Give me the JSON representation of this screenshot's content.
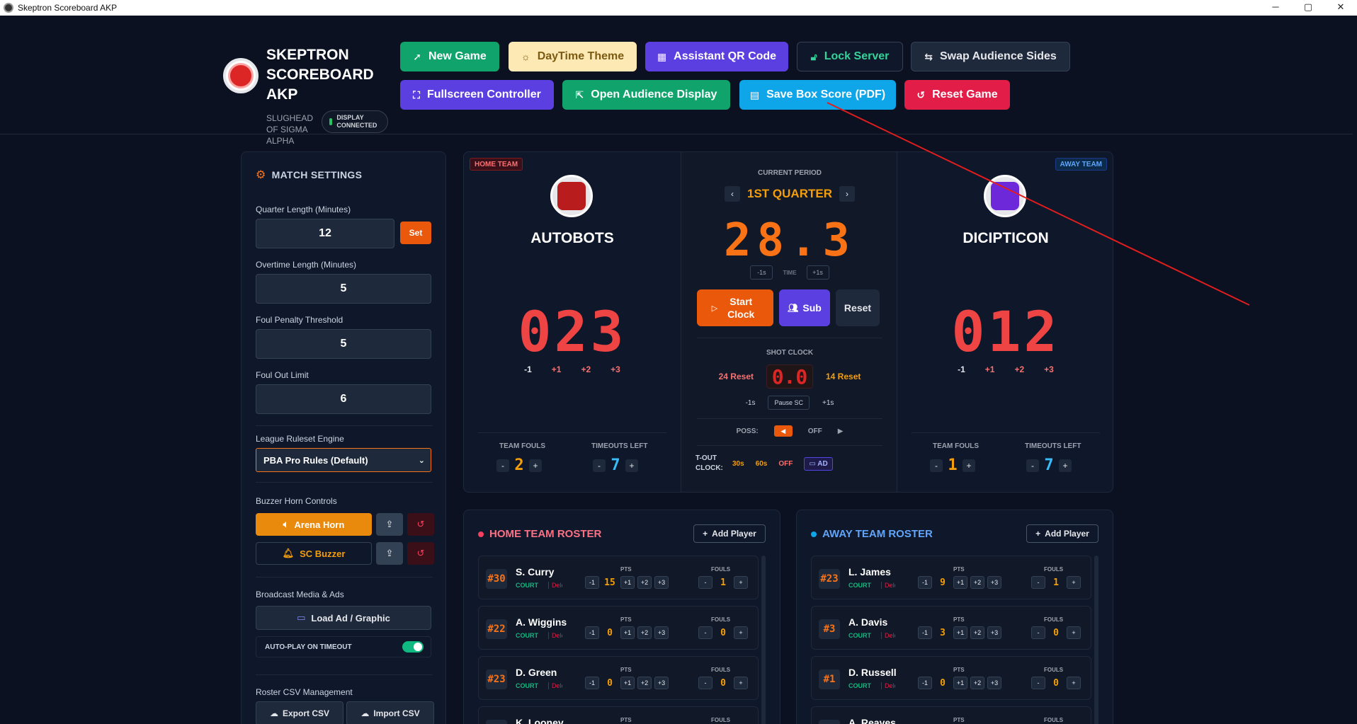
{
  "window": {
    "title": "Skeptron Scoreboard AKP",
    "controls": [
      "─",
      "▢",
      "✕"
    ]
  },
  "brand": {
    "title": "SKEPTRON SCOREBOARD AKP",
    "subtitle": "SLUGHEAD OF SIGMA ALPHA",
    "status": "DISPLAY CONNECTED"
  },
  "toolbar": {
    "new_game": "New Game",
    "daytime_theme": "DayTime Theme",
    "assistant_qr": "Assistant QR Code",
    "lock_server": "Lock Server",
    "swap_sides": "Swap Audience Sides",
    "fullscreen": "Fullscreen Controller",
    "open_display": "Open Audience Display",
    "save_box": "Save Box Score (PDF)",
    "reset_game": "Reset Game"
  },
  "settings": {
    "title": "MATCH SETTINGS",
    "quarter_label": "Quarter Length (Minutes)",
    "quarter_value": "12",
    "set_label": "Set",
    "ot_label": "Overtime Length (Minutes)",
    "ot_value": "5",
    "foul_penalty_label": "Foul Penalty Threshold",
    "foul_penalty_value": "5",
    "foul_out_label": "Foul Out Limit",
    "foul_out_value": "6",
    "ruleset_label": "League Ruleset Engine",
    "ruleset_value": "PBA Pro Rules (Default)",
    "horn_label": "Buzzer Horn Controls",
    "arena_horn": "Arena Horn",
    "sc_buzzer": "SC Buzzer",
    "media_label": "Broadcast Media & Ads",
    "load_ad": "Load Ad / Graphic",
    "autoplay": "AUTO-PLAY ON TIMEOUT",
    "csv_label": "Roster CSV Management",
    "export_csv": "Export CSV",
    "import_csv": "Import CSV"
  },
  "home": {
    "tag": "HOME TEAM",
    "name": "AUTOBOTS",
    "score": "023",
    "adj": [
      "-1",
      "+1",
      "+2",
      "+3"
    ],
    "fouls_label": "TEAM FOULS",
    "fouls": "2",
    "timeouts_label": "TIMEOUTS LEFT",
    "timeouts": "7"
  },
  "away": {
    "tag": "AWAY TEAM",
    "name": "DICIPTICON",
    "score": "012",
    "adj": [
      "-1",
      "+1",
      "+2",
      "+3"
    ],
    "fouls_label": "TEAM FOULS",
    "fouls": "1",
    "timeouts_label": "TIMEOUTS LEFT",
    "timeouts": "7"
  },
  "clock": {
    "period_label": "CURRENT PERIOD",
    "period": "1ST QUARTER",
    "time": "28.3",
    "minus": "-1s",
    "time_label": "TIME",
    "plus": "+1s",
    "start": "Start Clock",
    "sub": "Sub",
    "reset": "Reset",
    "shot_label": "SHOT CLOCK",
    "reset24": "24 Reset",
    "shot_value": "0.0",
    "reset14": "14 Reset",
    "sc_minus": "-1s",
    "pause_sc": "Pause SC",
    "sc_plus": "+1s",
    "poss_label": "POSS:",
    "poss_left": "◀",
    "poss_off": "OFF",
    "poss_right": "▶",
    "tout_label": "T-OUT CLOCK:",
    "t30": "30s",
    "t60": "60s",
    "toff": "OFF",
    "ad": "AD"
  },
  "home_roster": {
    "title": "HOME TEAM ROSTER",
    "add": "Add Player",
    "players": [
      {
        "num": "#30",
        "name": "S. Curry",
        "pts": "15",
        "fouls": "1"
      },
      {
        "num": "#22",
        "name": "A. Wiggins",
        "pts": "0",
        "fouls": "0"
      },
      {
        "num": "#23",
        "name": "D. Green",
        "pts": "0",
        "fouls": "0"
      },
      {
        "num": "",
        "name": "K. Looney",
        "pts": "",
        "fouls": ""
      }
    ]
  },
  "away_roster": {
    "title": "AWAY TEAM ROSTER",
    "add": "Add Player",
    "players": [
      {
        "num": "#23",
        "name": "L. James",
        "pts": "9",
        "fouls": "1"
      },
      {
        "num": "#3",
        "name": "A. Davis",
        "pts": "3",
        "fouls": "0"
      },
      {
        "num": "#1",
        "name": "D. Russell",
        "pts": "0",
        "fouls": "0"
      },
      {
        "num": "",
        "name": "A. Reaves",
        "pts": "",
        "fouls": ""
      }
    ]
  },
  "roster_labels": {
    "court": "COURT",
    "del": "Delete",
    "pts": "PTS",
    "fouls": "FOULS",
    "minus": "-1",
    "p1": "+1",
    "p2": "+2",
    "p3": "+3",
    "fminus": "-",
    "fplus": "+"
  },
  "colors": {
    "accent": "#f97316",
    "home": "#ef4444",
    "away": "#3b82f6",
    "annotation": "#e11d1d"
  }
}
